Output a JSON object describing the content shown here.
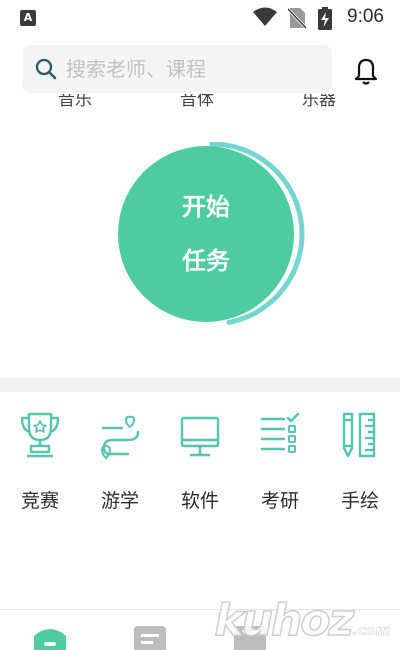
{
  "status_bar": {
    "time": "9:06",
    "app_icon_letter": "A"
  },
  "search": {
    "placeholder": "搜索老师、课程"
  },
  "tabs_clipped": [
    "音乐",
    "音体",
    "乐器"
  ],
  "start_task": {
    "line1": "开始",
    "line2": "任务",
    "progress": 0.47
  },
  "categories": [
    {
      "label": "竞赛",
      "icon": "trophy-icon"
    },
    {
      "label": "游学",
      "icon": "route-icon"
    },
    {
      "label": "软件",
      "icon": "monitor-icon"
    },
    {
      "label": "考研",
      "icon": "checklist-icon"
    },
    {
      "label": "手绘",
      "icon": "pencil-ruler-icon"
    }
  ],
  "bottom_nav": [
    {
      "icon": "home-icon",
      "active": true
    },
    {
      "icon": "list-icon",
      "active": false
    },
    {
      "icon": "bag-icon",
      "active": false
    }
  ],
  "watermark": {
    "text": "kuhoz",
    "suffix": ".com"
  },
  "colors": {
    "accent": "#4ccc9f",
    "icon": "#56c3b3",
    "ring": "#75d6cf"
  }
}
